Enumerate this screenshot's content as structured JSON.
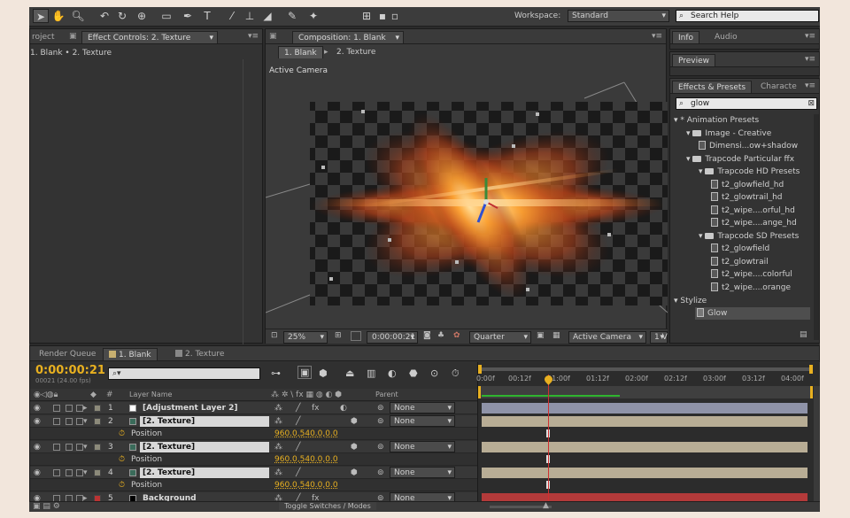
{
  "toolbar": {
    "workspace_label": "Workspace:",
    "workspace_value": "Standard",
    "search_help": "Search Help"
  },
  "left_panel": {
    "tab_project": "roject",
    "tab_effect_controls": "Effect Controls: 2. Texture",
    "breadcrumb": "1. Blank • 2. Texture"
  },
  "composition": {
    "tab_label": "Composition: 1. Blank",
    "subtab_active": "1. Blank",
    "subtab_other": "2. Texture",
    "camera_label": "Active Camera",
    "zoom": "25%",
    "timecode": "0:00:00:21",
    "resolution": "Quarter",
    "view": "Active Camera",
    "views_count": "1 V"
  },
  "right_panel": {
    "tab_info": "Info",
    "tab_audio": "Audio",
    "tab_preview": "Preview",
    "tab_effects": "Effects & Presets",
    "tab_character": "Characte",
    "search_value": "glow",
    "tree": [
      {
        "label": "* Animation Presets",
        "indent": 0,
        "type": "root"
      },
      {
        "label": "Image - Creative",
        "indent": 1,
        "type": "folder"
      },
      {
        "label": "Dimensi...ow+shadow",
        "indent": 2,
        "type": "preset"
      },
      {
        "label": "Trapcode Particular ffx",
        "indent": 1,
        "type": "folder"
      },
      {
        "label": "Trapcode HD Presets",
        "indent": 2,
        "type": "folder"
      },
      {
        "label": "t2_glowfield_hd",
        "indent": 3,
        "type": "preset"
      },
      {
        "label": "t2_glowtrail_hd",
        "indent": 3,
        "type": "preset"
      },
      {
        "label": "t2_wipe....orful_hd",
        "indent": 3,
        "type": "preset"
      },
      {
        "label": "t2_wipe....ange_hd",
        "indent": 3,
        "type": "preset"
      },
      {
        "label": "Trapcode SD Presets",
        "indent": 2,
        "type": "folder"
      },
      {
        "label": "t2_glowfield",
        "indent": 3,
        "type": "preset"
      },
      {
        "label": "t2_glowtrail",
        "indent": 3,
        "type": "preset"
      },
      {
        "label": "t2_wipe....colorful",
        "indent": 3,
        "type": "preset"
      },
      {
        "label": "t2_wipe....orange",
        "indent": 3,
        "type": "preset"
      }
    ],
    "stylize_label": "Stylize",
    "glow_label": "Glow"
  },
  "timeline": {
    "tab_render_queue": "Render Queue",
    "tab_blank": "1. Blank",
    "tab_texture": "2. Texture",
    "timecode": "0:00:00:21",
    "fps": "00021 (24.00 fps)",
    "col_layer_name": "Layer Name",
    "col_parent": "Parent",
    "ruler": [
      "0:00f",
      "00:12f",
      "01:00f",
      "01:12f",
      "02:00f",
      "02:12f",
      "03:00f",
      "03:12f",
      "04:00f"
    ],
    "rows": [
      {
        "kind": "layer",
        "num": "1",
        "name": "[Adjustment Layer 2]",
        "parent": "None",
        "color": "#ffffff",
        "boxed": false
      },
      {
        "kind": "layer",
        "num": "2",
        "name": "[2. Texture]",
        "parent": "None",
        "color": "#3a6b5a",
        "boxed": true
      },
      {
        "kind": "prop",
        "name": "Position",
        "value": "960.0,540.0,0.0"
      },
      {
        "kind": "layer",
        "num": "3",
        "name": "[2. Texture]",
        "parent": "None",
        "color": "#3a6b5a",
        "boxed": true
      },
      {
        "kind": "prop",
        "name": "Position",
        "value": "960.0,540.0,0.0"
      },
      {
        "kind": "layer",
        "num": "4",
        "name": "[2. Texture]",
        "parent": "None",
        "color": "#3a6b5a",
        "boxed": true
      },
      {
        "kind": "prop",
        "name": "Position",
        "value": "960.0,540.0,0.0"
      },
      {
        "kind": "layer",
        "num": "5",
        "name": "Background",
        "parent": "None",
        "color": "#000000",
        "boxed": false
      }
    ],
    "bar_colors": {
      "adjustment": "#8f93a8",
      "texture": "#b8ad95",
      "background": "#b33a3a"
    },
    "toggle_label": "Toggle Switches / Modes"
  }
}
